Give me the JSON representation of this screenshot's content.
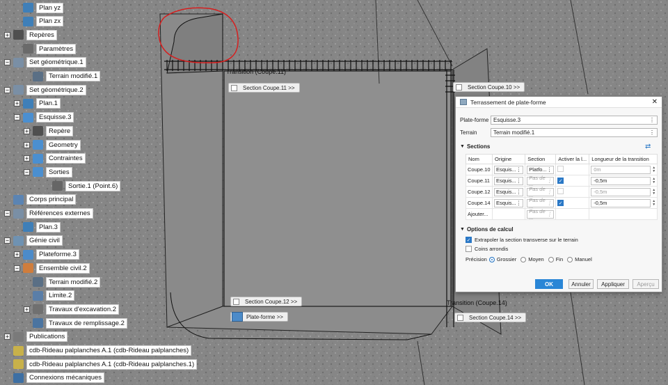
{
  "tree": [
    {
      "label": "Plan yz",
      "icon": "plane-icon",
      "expander": ""
    },
    {
      "label": "Plan zx",
      "icon": "plane-icon",
      "expander": ""
    },
    {
      "label": "Repères",
      "icon": "axis-icon",
      "expander": "+"
    },
    {
      "label": "Paramètres",
      "icon": "parameters-icon",
      "expander": ""
    },
    {
      "label": "Set géométrique.1",
      "icon": "geometric-set-icon",
      "expander": "−"
    },
    {
      "label": "Terrain modifié.1",
      "icon": "terrain-icon",
      "expander": ""
    },
    {
      "label": "Set géométrique.2",
      "icon": "geometric-set-icon",
      "expander": "−"
    },
    {
      "label": "Plan.1",
      "icon": "plane-icon",
      "expander": "+"
    },
    {
      "label": "Esquisse.3",
      "icon": "sketch-icon",
      "expander": "−"
    },
    {
      "label": "Repère",
      "icon": "axis-icon",
      "expander": "+"
    },
    {
      "label": "Geometry",
      "icon": "geometry-icon",
      "expander": "+"
    },
    {
      "label": "Contraintes",
      "icon": "constraints-icon",
      "expander": "+"
    },
    {
      "label": "Sorties",
      "icon": "outputs-icon",
      "expander": "−"
    },
    {
      "label": "Sortie.1 (Point.6)",
      "icon": "point-icon",
      "expander": ""
    },
    {
      "label": "Corps principal",
      "icon": "body-icon",
      "expander": ""
    },
    {
      "label": "Références externes",
      "icon": "external-references-icon",
      "expander": "−"
    },
    {
      "label": "Plan.3",
      "icon": "plane-icon",
      "expander": ""
    },
    {
      "label": "Génie civil",
      "icon": "civil-engineering-icon",
      "expander": "−"
    },
    {
      "label": "Plateforme.3",
      "icon": "platform-icon",
      "expander": "+"
    },
    {
      "label": "Ensemble civil.2",
      "icon": "civil-assembly-icon",
      "expander": "−"
    },
    {
      "label": "Terrain modifié.2",
      "icon": "terrain-icon",
      "expander": ""
    },
    {
      "label": "Limite.2",
      "icon": "limit-icon",
      "expander": ""
    },
    {
      "label": "Travaux d'excavation.2",
      "icon": "excavation-icon",
      "expander": "+"
    },
    {
      "label": "Travaux de remplissage.2",
      "icon": "fill-icon",
      "expander": ""
    },
    {
      "label": "Publications",
      "icon": "publications-icon",
      "expander": "+"
    },
    {
      "label": "cdb-Rideau palplanches A.1 (cdb-Rideau palplanches)",
      "icon": "component-icon",
      "expander": ""
    },
    {
      "label": "cdb-Rideau palplanches A.1 (cdb-Rideau palplanches.1)",
      "icon": "component-icon",
      "expander": ""
    },
    {
      "label": "Connexions mécaniques",
      "icon": "mechanical-connections-icon",
      "expander": ""
    }
  ],
  "viewport": {
    "tags": {
      "coupe11": "Section Coupe.11 >>",
      "coupe10": "Section Coupe.10 >>",
      "coupe12": "Section Coupe.12 >>",
      "coupe14": "Section Coupe.14 >>",
      "platform": "Plate-forme >>"
    },
    "labels": {
      "transition11": "Transition (Coupe.11)",
      "transition14": "Transition (Coupe.14)"
    }
  },
  "dialog": {
    "title": "Terrassement de plate-forme",
    "platform_label": "Plate-forme",
    "platform_value": "Esquisse.3",
    "terrain_label": "Terrain",
    "terrain_value": "Terrain modifié.1",
    "sections_title": "Sections",
    "columns": [
      "Nom",
      "Origine",
      "Section",
      "Activer la l...",
      "Longueur de la transition"
    ],
    "rows": [
      {
        "name": "Coupe.10",
        "origin": "Esquis...",
        "section": "Platfo...",
        "section_placeholder": false,
        "active": false,
        "active_dim": true,
        "length": "0m",
        "length_disabled": true
      },
      {
        "name": "Coupe.11",
        "origin": "Esquis...",
        "section": "Pas de ...",
        "section_placeholder": true,
        "active": true,
        "active_dim": false,
        "length": "-0,5m",
        "length_disabled": false
      },
      {
        "name": "Coupe.12",
        "origin": "Esquis...",
        "section": "Pas de ...",
        "section_placeholder": true,
        "active": false,
        "active_dim": true,
        "length": "-0,5m",
        "length_disabled": true
      },
      {
        "name": "Coupe.14",
        "origin": "Esquis...",
        "section": "Pas de ...",
        "section_placeholder": true,
        "active": true,
        "active_dim": false,
        "length": "-0,5m",
        "length_disabled": false
      }
    ],
    "add_row_label": "Ajouter...",
    "add_row_placeholder": "Pas de ...",
    "options_title": "Options de calcul",
    "extrapolate_label": "Extrapoler la section transverse sur le terrain",
    "rounded_label": "Coins arrondis",
    "precision_label": "Précision",
    "precision_options": [
      "Grossier",
      "Moyen",
      "Fin",
      "Manuel"
    ],
    "precision_selected": "Grossier",
    "buttons": {
      "ok": "OK",
      "cancel": "Annuler",
      "apply": "Appliquer",
      "preview": "Aperçu"
    }
  }
}
